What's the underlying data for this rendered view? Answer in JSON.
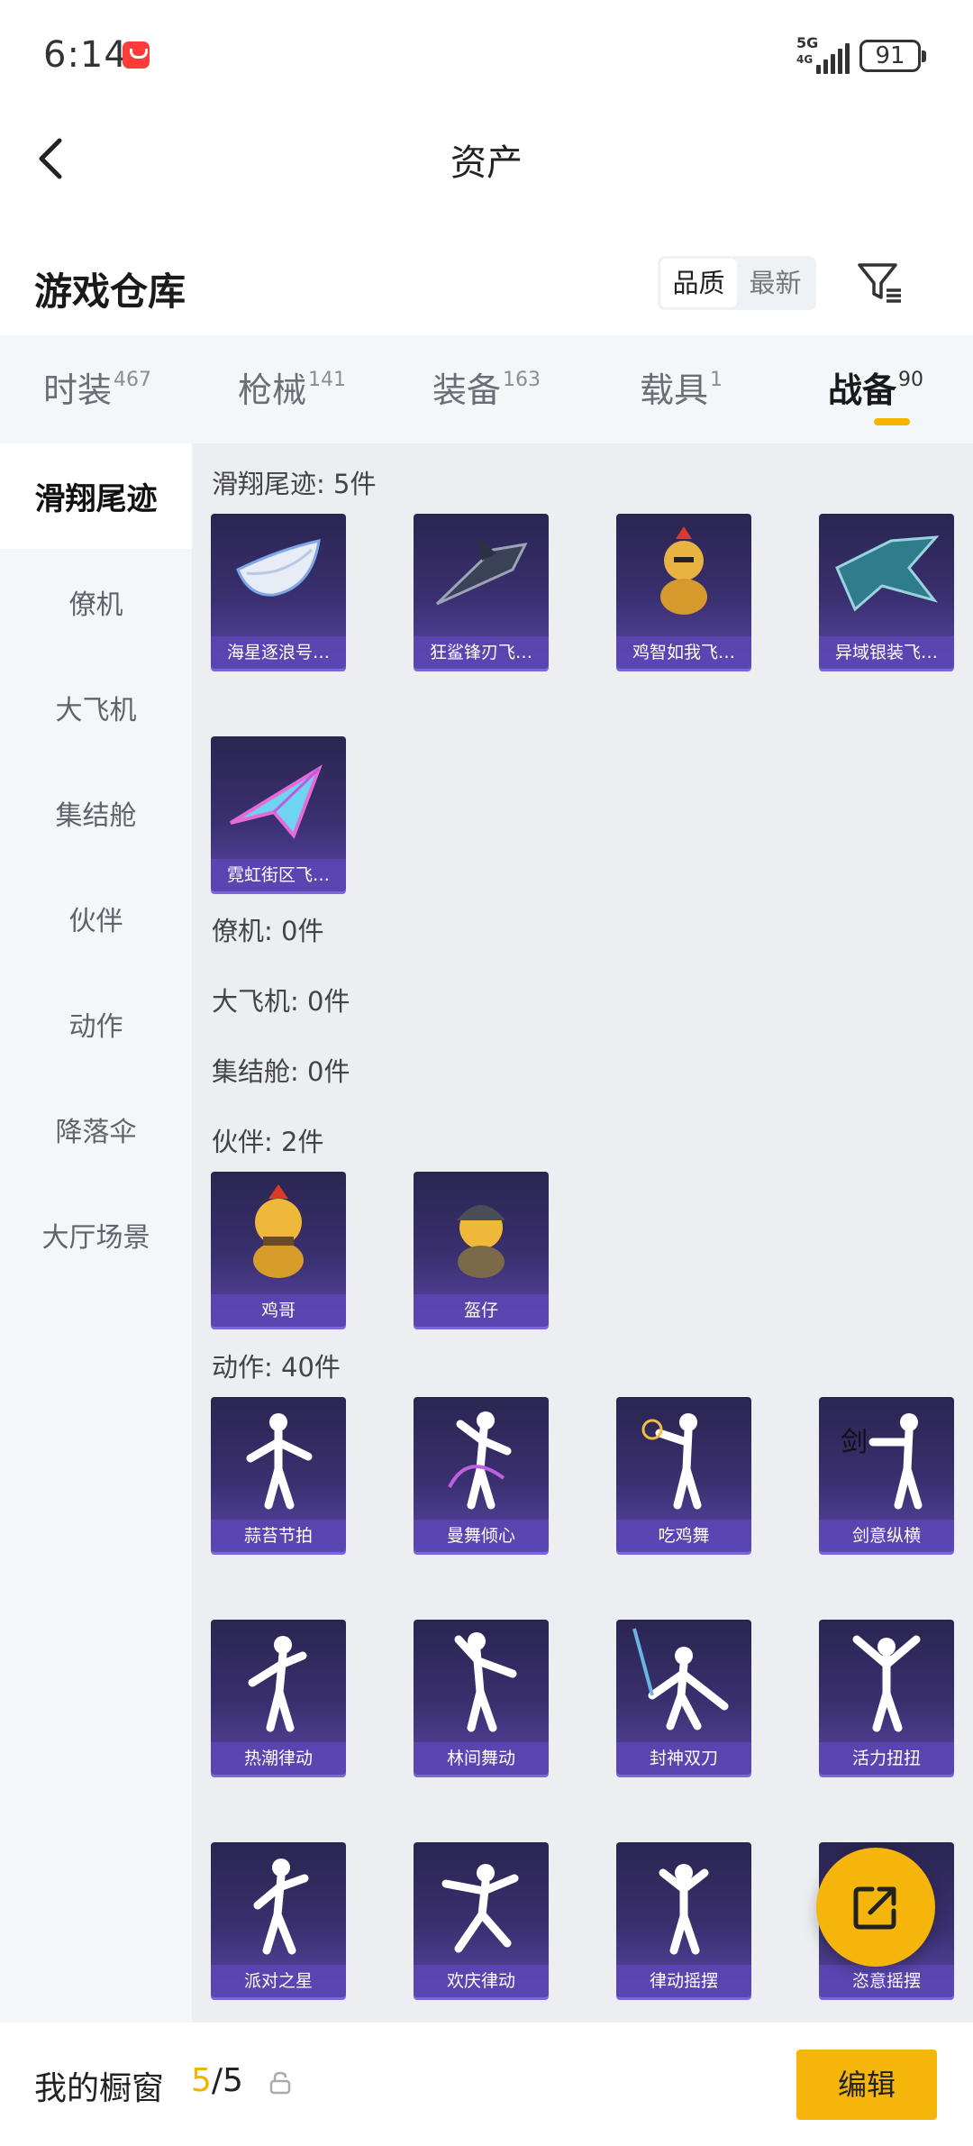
{
  "status_bar": {
    "time": "6:14",
    "network": "5G",
    "network_sub": "4G",
    "battery": "91"
  },
  "header": {
    "title": "资产",
    "back_icon": "chevron-left-icon"
  },
  "warehouse": {
    "title": "游戏仓库",
    "sort_options": [
      "品质",
      "最新"
    ],
    "sort_selected": "品质",
    "filter_icon": "filter-icon"
  },
  "tabs": [
    {
      "label": "时装",
      "count": "467",
      "active": false
    },
    {
      "label": "枪械",
      "count": "141",
      "active": false
    },
    {
      "label": "装备",
      "count": "163",
      "active": false
    },
    {
      "label": "载具",
      "count": "1",
      "active": false
    },
    {
      "label": "战备",
      "count": "90",
      "active": true
    }
  ],
  "sidebar": {
    "items": [
      {
        "label": "滑翔尾迹",
        "active": true
      },
      {
        "label": "僚机",
        "active": false
      },
      {
        "label": "大飞机",
        "active": false
      },
      {
        "label": "集结舱",
        "active": false
      },
      {
        "label": "伙伴",
        "active": false
      },
      {
        "label": "动作",
        "active": false
      },
      {
        "label": "降落伞",
        "active": false
      },
      {
        "label": "大厅场景",
        "active": false
      }
    ]
  },
  "sections": {
    "glide_trail": {
      "title": "滑翔尾迹: 5件",
      "items": [
        "海星逐浪号…",
        "狂鲨锋刃飞…",
        "鸡智如我飞…",
        "异域银装飞…",
        "霓虹街区飞…"
      ]
    },
    "wingman": {
      "title": "僚机: 0件"
    },
    "big_plane": {
      "title": "大飞机: 0件"
    },
    "capsule": {
      "title": "集结舱: 0件"
    },
    "companion": {
      "title": "伙伴: 2件",
      "items": [
        "鸡哥",
        "盔仔"
      ]
    },
    "emote": {
      "title": "动作: 40件",
      "items": [
        "蒜苔节拍",
        "曼舞倾心",
        "吃鸡舞",
        "剑意纵横",
        "热潮律动",
        "林间舞动",
        "封神双刀",
        "活力扭扭",
        "派对之星",
        "欢庆律动",
        "律动摇摆",
        "恣意摇摆"
      ]
    }
  },
  "fab": {
    "icon": "share-external-icon"
  },
  "bottom_bar": {
    "label": "我的橱窗",
    "count_current": "5",
    "count_total": "/5",
    "lock_icon": "lock-icon",
    "edit_label": "编辑"
  },
  "colors": {
    "accent": "#f5b400",
    "card_top": "#2a2550",
    "card_bottom": "#5a47a8"
  }
}
